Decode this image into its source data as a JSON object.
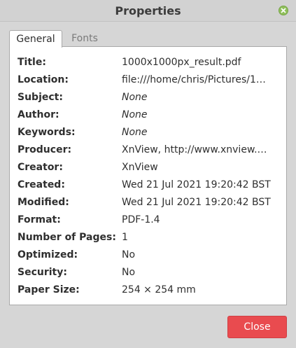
{
  "window": {
    "title": "Properties",
    "close_icon": "close-x-icon",
    "accent_close": "#8fbf5a"
  },
  "tabs": [
    {
      "label": "General",
      "selected": true
    },
    {
      "label": "Fonts",
      "selected": false
    }
  ],
  "properties": [
    {
      "label": "Title:",
      "value": "1000x1000px_result.pdf",
      "italic": false
    },
    {
      "label": "Location:",
      "value": "file:///home/chris/Pictures/1…",
      "italic": false
    },
    {
      "label": "Subject:",
      "value": "None",
      "italic": true
    },
    {
      "label": "Author:",
      "value": "None",
      "italic": true
    },
    {
      "label": "Keywords:",
      "value": "None",
      "italic": true
    },
    {
      "label": "Producer:",
      "value": "XnView, http://www.xnview.…",
      "italic": false
    },
    {
      "label": "Creator:",
      "value": "XnView",
      "italic": false
    },
    {
      "label": "Created:",
      "value": "Wed 21 Jul 2021 19:20:42 BST",
      "italic": false
    },
    {
      "label": "Modified:",
      "value": "Wed 21 Jul 2021 19:20:42 BST",
      "italic": false
    },
    {
      "label": "Format:",
      "value": "PDF-1.4",
      "italic": false
    },
    {
      "label": "Number of Pages:",
      "value": "1",
      "italic": false
    },
    {
      "label": "Optimized:",
      "value": "No",
      "italic": false
    },
    {
      "label": "Security:",
      "value": "No",
      "italic": false
    },
    {
      "label": "Paper Size:",
      "value": "254 × 254 mm",
      "italic": false
    }
  ],
  "footer": {
    "close_label": "Close",
    "close_color": "#e94b4f"
  }
}
